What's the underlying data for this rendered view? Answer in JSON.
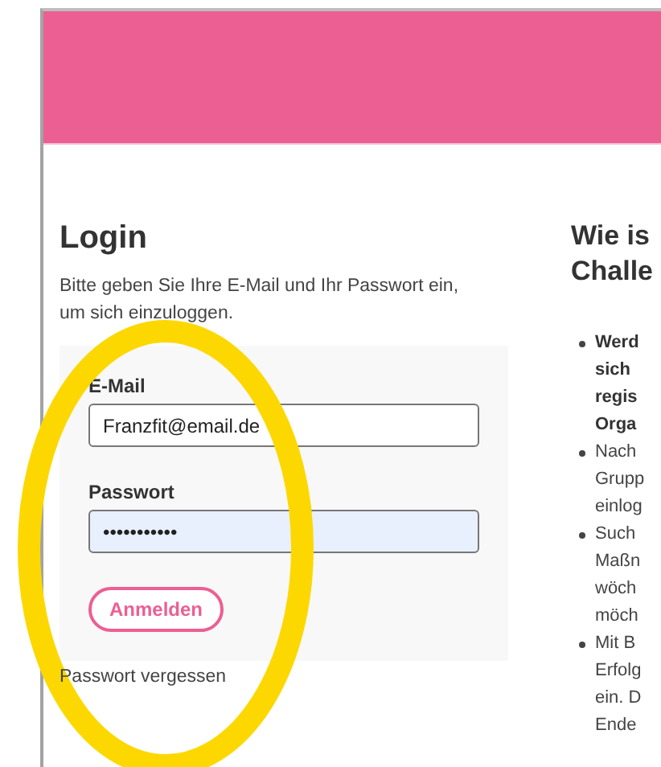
{
  "login": {
    "title": "Login",
    "intro": "Bitte geben Sie Ihre E-Mail und Ihr Passwort ein, um sich einzuloggen.",
    "fields": [
      {
        "label": "E-Mail",
        "value": "Franzfit@email.de",
        "autofilled": false
      },
      {
        "label": "Passwort",
        "value": "•••••••••••",
        "autofilled": true
      }
    ],
    "submit": "Anmelden",
    "forgot": "Passwort vergessen"
  },
  "info": {
    "title_lines": [
      "Wie is",
      "Challe"
    ],
    "bullets": [
      {
        "bold": true,
        "lines": [
          "Werd",
          "sich",
          "regis",
          "Orga"
        ]
      },
      {
        "bold": false,
        "lines": [
          "Nach",
          "Grupp",
          "einlog"
        ]
      },
      {
        "bold": false,
        "lines": [
          "Such",
          "Maßn",
          "wöch",
          "möch"
        ]
      },
      {
        "bold": false,
        "lines": [
          "Mit B",
          "Erfolg",
          "ein. D",
          "Ende"
        ]
      }
    ]
  }
}
